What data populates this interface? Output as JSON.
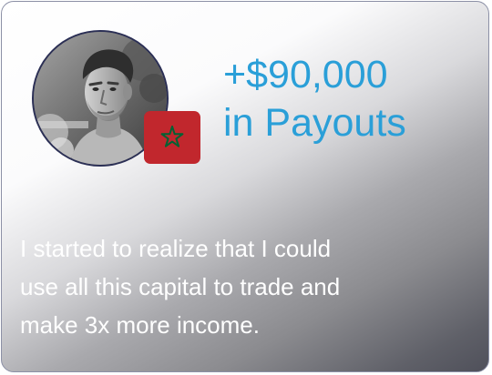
{
  "testimonial": {
    "payout_amount": "+$90,000",
    "payout_label": "in Payouts",
    "quote": "I started to realize that I could\nuse all this capital to trade and\nmake 3x more income."
  },
  "icons": {
    "avatar": "user-photo",
    "flag": "morocco-flag-icon"
  },
  "colors": {
    "accent": "#2a9fd8",
    "flag_red": "#c1272d",
    "flag_star": "#006233",
    "border": "#8c90a6"
  }
}
